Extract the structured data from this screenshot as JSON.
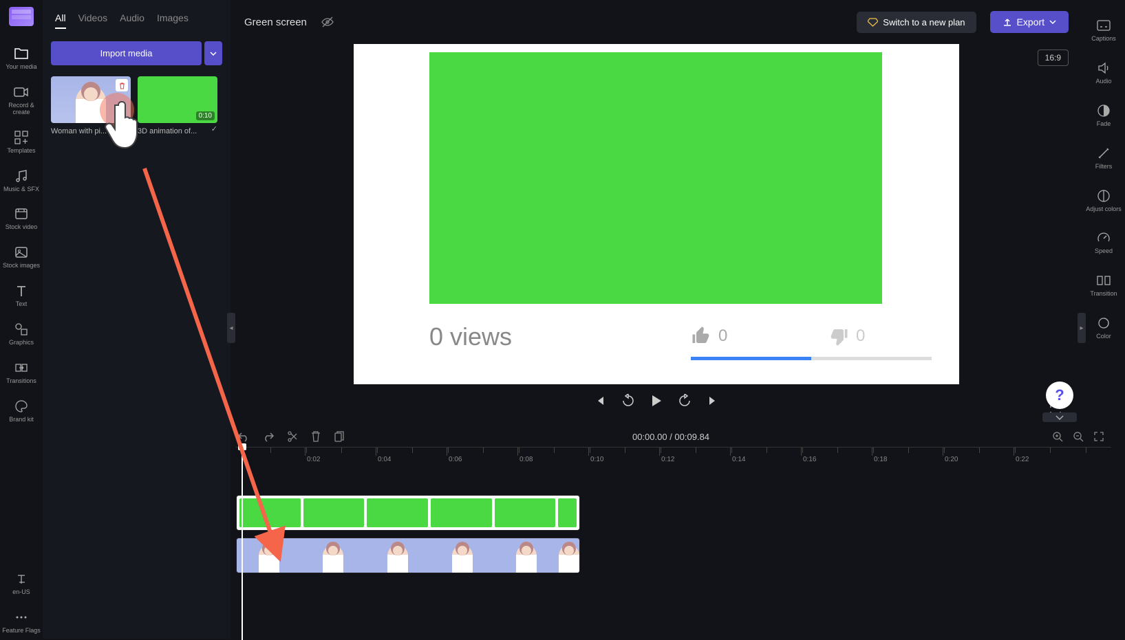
{
  "left_rail": {
    "items": [
      {
        "label": "Your media"
      },
      {
        "label": "Record & create"
      },
      {
        "label": "Templates"
      },
      {
        "label": "Music & SFX"
      },
      {
        "label": "Stock video"
      },
      {
        "label": "Stock images"
      },
      {
        "label": "Text"
      },
      {
        "label": "Graphics"
      },
      {
        "label": "Transitions"
      },
      {
        "label": "Brand kit"
      }
    ],
    "bottom": [
      {
        "label": "en-US"
      },
      {
        "label": "Feature Flags"
      }
    ]
  },
  "media_panel": {
    "tabs": [
      "All",
      "Videos",
      "Audio",
      "Images"
    ],
    "import_label": "Import media",
    "thumbs": [
      {
        "caption": "Woman with pi...",
        "duration": ""
      },
      {
        "caption": "3D animation of...",
        "duration": "0:10"
      }
    ]
  },
  "topbar": {
    "title": "Green screen",
    "plan_label": "Switch to a new plan",
    "export_label": "Export"
  },
  "preview": {
    "views": "0 views",
    "like_count": "0",
    "dislike_count": "0",
    "aspect": "16:9"
  },
  "right_rail": {
    "items": [
      {
        "label": "Captions"
      },
      {
        "label": "Audio"
      },
      {
        "label": "Fade"
      },
      {
        "label": "Filters"
      },
      {
        "label": "Adjust colors"
      },
      {
        "label": "Speed"
      },
      {
        "label": "Transition"
      },
      {
        "label": "Color"
      }
    ]
  },
  "timeline": {
    "current": "00:00.00",
    "sep": " / ",
    "total": "00:09.84",
    "ticks": [
      "0:02",
      "0:04",
      "0:06",
      "0:08",
      "0:10",
      "0:12",
      "0:14",
      "0:16",
      "0:18",
      "0:20",
      "0:22"
    ]
  }
}
